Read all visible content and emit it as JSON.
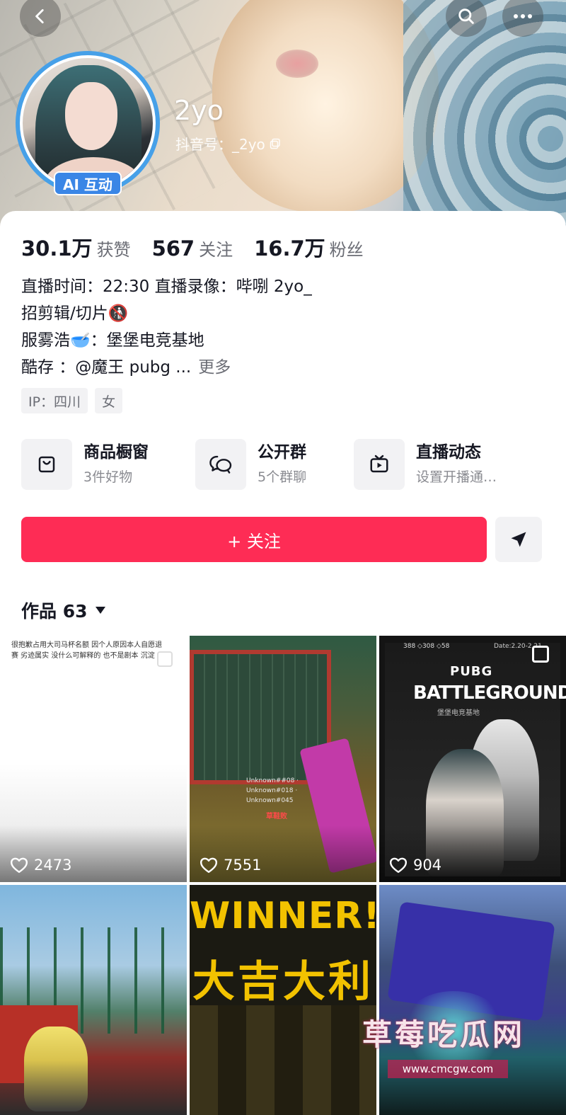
{
  "header": {
    "nickname": "2yo",
    "douyin_id": "抖音号：_2yo",
    "ai_badge": "AI 互动",
    "icons": {
      "back": "chevron-left-icon",
      "search": "search-icon",
      "more": "ellipsis-icon",
      "copy": "copy-icon"
    }
  },
  "stats": [
    {
      "value": "30.1万",
      "label": "获赞"
    },
    {
      "value": "567",
      "label": "关注"
    },
    {
      "value": "16.7万",
      "label": "粉丝"
    }
  ],
  "bio": {
    "line1": "直播时间：22:30 直播录像：哔哵 2yo_",
    "line2": "招剪辑/切片🚯",
    "line3": "服雾浩🥣：堡堡电竞基地",
    "line4": "酷存      ：@魔王 pubg ...",
    "more": "更多"
  },
  "tags": [
    "IP：四川",
    "女"
  ],
  "features": [
    {
      "title": "商品橱窗",
      "sub": "3件好物",
      "icon": "shopping-bag-icon"
    },
    {
      "title": "公开群",
      "sub": "5个群聊",
      "icon": "chat-bubbles-icon"
    },
    {
      "title": "直播动态",
      "sub": "设置开播通…",
      "icon": "tv-icon"
    }
  ],
  "follow_label": "+ 关注",
  "works_label": "作品 63",
  "videos": [
    {
      "likes": "2473",
      "caption": "很抱歉占用大司马杯名额 因个人原因本人自愿退赛 劣迹属实 没什么可解释的 也不是剧本 沉淀"
    },
    {
      "likes": "7551",
      "feed": "Unknown##08 · Unknown#018 · Unknown#045",
      "overlay": "草鞋败"
    },
    {
      "likes": "904",
      "hud": "388 ◇308 ◇58",
      "date": "Date:2.20-2.21",
      "brand": "PUBG",
      "title": "BATTLEGROUNDS",
      "sub": "堡堡电竞基地"
    },
    {
      "likes": ""
    },
    {
      "likes": "",
      "winner": "WINNER!",
      "cn": "大吉大利"
    },
    {
      "likes": ""
    }
  ],
  "watermark": {
    "title": "草莓吃瓜网",
    "url": "www.cmcgw.com"
  },
  "colors": {
    "accent": "#fe2c55",
    "badge": "#3a86e6",
    "gray_text": "#6b6d75"
  }
}
